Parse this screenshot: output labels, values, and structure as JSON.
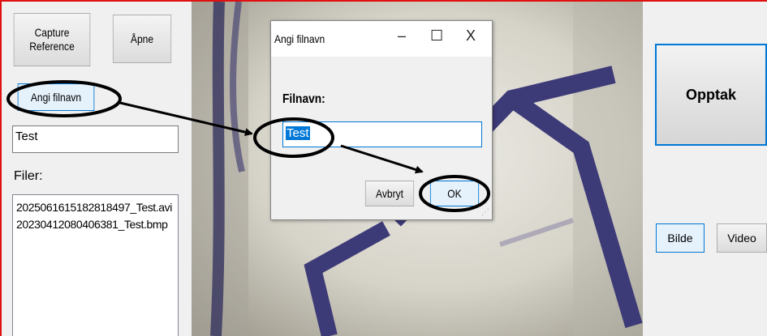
{
  "left_panel": {
    "capture_reference_line1": "Capture",
    "capture_reference_line2": "Reference",
    "open_label": "Åpne",
    "set_filename_label": "Angi filnavn",
    "name_input_value": "Test",
    "files_label": "Filer:",
    "files": [
      "20250616151828184​97_Test.avi",
      "20230412080406381_Test.bmp"
    ]
  },
  "dialog": {
    "title": "Angi filnavn",
    "minimize_glyph": "–",
    "maximize_glyph": "☐",
    "close_glyph": "X",
    "field_label": "Filnavn:",
    "field_value": "Test",
    "cancel_label": "Avbryt",
    "ok_label": "OK"
  },
  "right_panel": {
    "record_label": "Opptak",
    "image_label": "Bilde",
    "video_label": "Video"
  },
  "colors": {
    "frame_border": "#e01010",
    "accent_blue": "#0078d7",
    "annotation": "#000000"
  }
}
